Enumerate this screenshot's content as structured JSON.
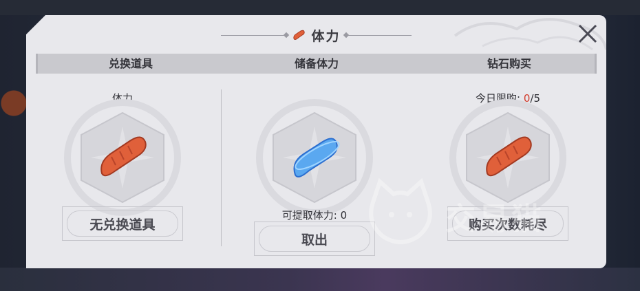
{
  "dialog": {
    "title": "体力",
    "title_icon": "sausage-icon"
  },
  "columns": [
    {
      "header": "兑换道具",
      "label": "体力",
      "item_icon": "sausage-icon",
      "button_label": "无兑换道具"
    },
    {
      "header": "储备体力",
      "label_prefix": "可提取体力:",
      "label_value": "0",
      "item_icon": "blue-stamina-icon",
      "button_label": "取出"
    },
    {
      "header": "钻石购买",
      "label_prefix": "今日限购:",
      "limit_used": "0",
      "limit_total": "/5",
      "item_icon": "sausage-icon",
      "button_label": "购买次数耗尽"
    }
  ],
  "watermark": {
    "text": "交易猫",
    "icon": "cat-logo-icon"
  },
  "colors": {
    "panel_bg": "#e8e8ec",
    "header_bg": "#c9c9ce",
    "accent_red": "#d23a2a"
  }
}
